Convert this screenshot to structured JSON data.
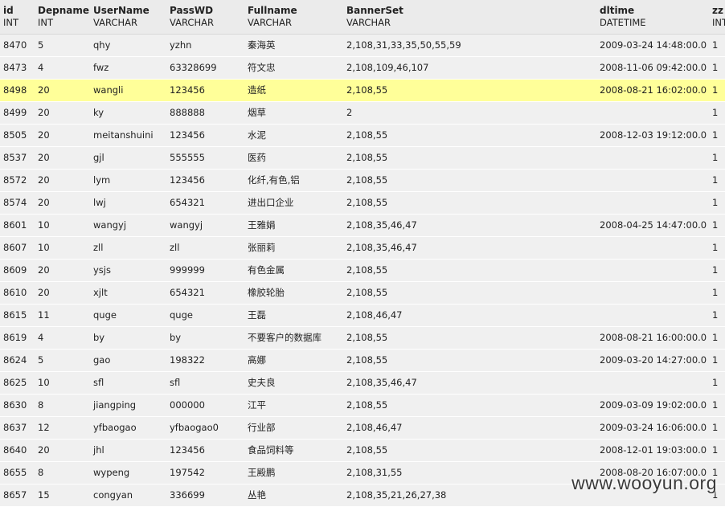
{
  "columns": [
    {
      "name": "id",
      "type": "INT"
    },
    {
      "name": "Depname",
      "type": "INT"
    },
    {
      "name": "UserName",
      "type": "VARCHAR"
    },
    {
      "name": "PassWD",
      "type": "VARCHAR"
    },
    {
      "name": "Fullname",
      "type": "VARCHAR"
    },
    {
      "name": "BannerSet",
      "type": "VARCHAR"
    },
    {
      "name": "dltime",
      "type": "DATETIME"
    },
    {
      "name": "zz",
      "type": "INT"
    }
  ],
  "highlight_color": "#ffff99",
  "highlighted_row_index": 2,
  "rows": [
    [
      "8470",
      "5",
      "qhy",
      "yzhn",
      "秦海英",
      "2,108,31,33,35,50,55,59",
      "2009-03-24 14:48:00.0",
      "1"
    ],
    [
      "8473",
      "4",
      "fwz",
      "63328699",
      "符文忠",
      "2,108,109,46,107",
      "2008-11-06 09:42:00.0",
      "1"
    ],
    [
      "8498",
      "20",
      "wangli",
      "123456",
      "造纸",
      "2,108,55",
      "2008-08-21 16:02:00.0",
      "1"
    ],
    [
      "8499",
      "20",
      "ky",
      "888888",
      "烟草",
      "2",
      "",
      "1"
    ],
    [
      "8505",
      "20",
      "meitanshuini",
      "123456",
      "水泥",
      "2,108,55",
      "2008-12-03 19:12:00.0",
      "1"
    ],
    [
      "8537",
      "20",
      "gjl",
      "555555",
      "医药",
      "2,108,55",
      "",
      "1"
    ],
    [
      "8572",
      "20",
      "lym",
      "123456",
      "化纤,有色,铝",
      "2,108,55",
      "",
      "1"
    ],
    [
      "8574",
      "20",
      "lwj",
      "654321",
      "进出口企业",
      "2,108,55",
      "",
      "1"
    ],
    [
      "8601",
      "10",
      "wangyj",
      "wangyj",
      "王雅娟",
      "2,108,35,46,47",
      "2008-04-25 14:47:00.0",
      "1"
    ],
    [
      "8607",
      "10",
      "zll",
      "zll",
      "张丽莉",
      "2,108,35,46,47",
      "",
      "1"
    ],
    [
      "8609",
      "20",
      "ysjs",
      "999999",
      "有色金属",
      "2,108,55",
      "",
      "1"
    ],
    [
      "8610",
      "20",
      "xjlt",
      "654321",
      "橡胶轮胎",
      "2,108,55",
      "",
      "1"
    ],
    [
      "8615",
      "11",
      "quge",
      "quge",
      "王磊",
      "2,108,46,47",
      "",
      "1"
    ],
    [
      "8619",
      "4",
      "by",
      "by",
      "不要客户的数据库",
      "2,108,55",
      "2008-08-21 16:00:00.0",
      "1"
    ],
    [
      "8624",
      "5",
      "gao",
      "198322",
      "高娜",
      "2,108,55",
      "2009-03-20 14:27:00.0",
      "1"
    ],
    [
      "8625",
      "10",
      "sfl",
      "sfl",
      "史夫良",
      "2,108,35,46,47",
      "",
      "1"
    ],
    [
      "8630",
      "8",
      "jiangping",
      "000000",
      "江平",
      "2,108,55",
      "2009-03-09 19:02:00.0",
      "1"
    ],
    [
      "8637",
      "12",
      "yfbaogao",
      "yfbaogao0",
      "行业部",
      "2,108,46,47",
      "2009-03-24 16:06:00.0",
      "1"
    ],
    [
      "8640",
      "20",
      "jhl",
      "123456",
      "食品饲料等",
      "2,108,55",
      "2008-12-01 19:03:00.0",
      "1"
    ],
    [
      "8655",
      "8",
      "wypeng",
      "197542",
      "王殿鹏",
      "2,108,31,55",
      "2008-08-20 16:07:00.0",
      "1"
    ],
    [
      "8657",
      "15",
      "congyan",
      "336699",
      "丛艳",
      "2,108,35,21,26,27,38",
      "",
      "1"
    ]
  ],
  "watermark": "www.wooyun.org"
}
